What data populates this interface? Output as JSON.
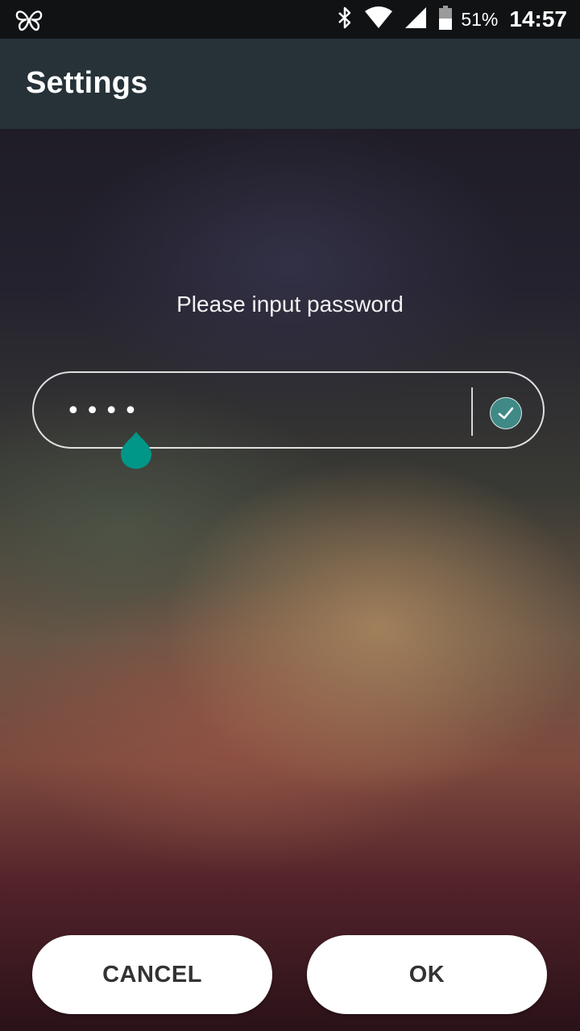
{
  "status_bar": {
    "left_icon": "butterfly-icon",
    "icons": [
      "bluetooth-icon",
      "wifi-icon",
      "cell-signal-icon",
      "battery-icon"
    ],
    "battery_percent": "51%",
    "time": "14:57"
  },
  "app_bar": {
    "title": "Settings"
  },
  "password_screen": {
    "prompt": "Please input password",
    "value": "••••",
    "confirm_icon": "checkmark-icon"
  },
  "buttons": {
    "cancel_label": "CANCEL",
    "ok_label": "OK"
  },
  "colors": {
    "app_bar": "#263238",
    "status_bar": "#111214",
    "accent": "#009688",
    "confirm": "#3f8a86",
    "button_bg": "#ffffff",
    "button_text": "#333333"
  }
}
